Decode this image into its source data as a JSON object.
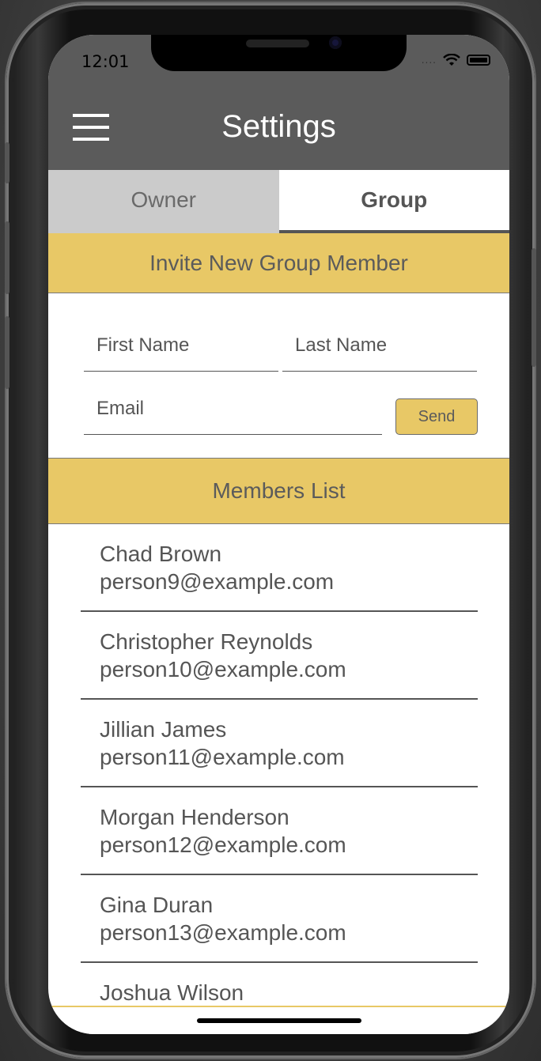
{
  "status_bar": {
    "time": "12:01",
    "signal": "....",
    "wifi_icon": "wifi-icon",
    "battery_icon": "battery-icon"
  },
  "nav": {
    "title": "Settings",
    "menu_icon": "hamburger-menu-icon"
  },
  "tabs": [
    {
      "label": "Owner",
      "selected": false
    },
    {
      "label": "Group",
      "selected": true
    }
  ],
  "invite": {
    "header": "Invite New Group Member",
    "first_name_placeholder": "First Name",
    "last_name_placeholder": "Last Name",
    "email_placeholder": "Email",
    "send_label": "Send"
  },
  "members": {
    "header": "Members List",
    "items": [
      {
        "name": "Chad Brown",
        "email": "person9@example.com"
      },
      {
        "name": "Christopher Reynolds",
        "email": "person10@example.com"
      },
      {
        "name": "Jillian James",
        "email": "person11@example.com"
      },
      {
        "name": "Morgan Henderson",
        "email": "person12@example.com"
      },
      {
        "name": "Gina Duran",
        "email": "person13@example.com"
      },
      {
        "name": "Joshua Wilson",
        "email": ""
      }
    ]
  },
  "colors": {
    "header_gray": "#5b5b5b",
    "accent_gold": "#e8c866",
    "tab_inactive": "#cbcbcb"
  }
}
